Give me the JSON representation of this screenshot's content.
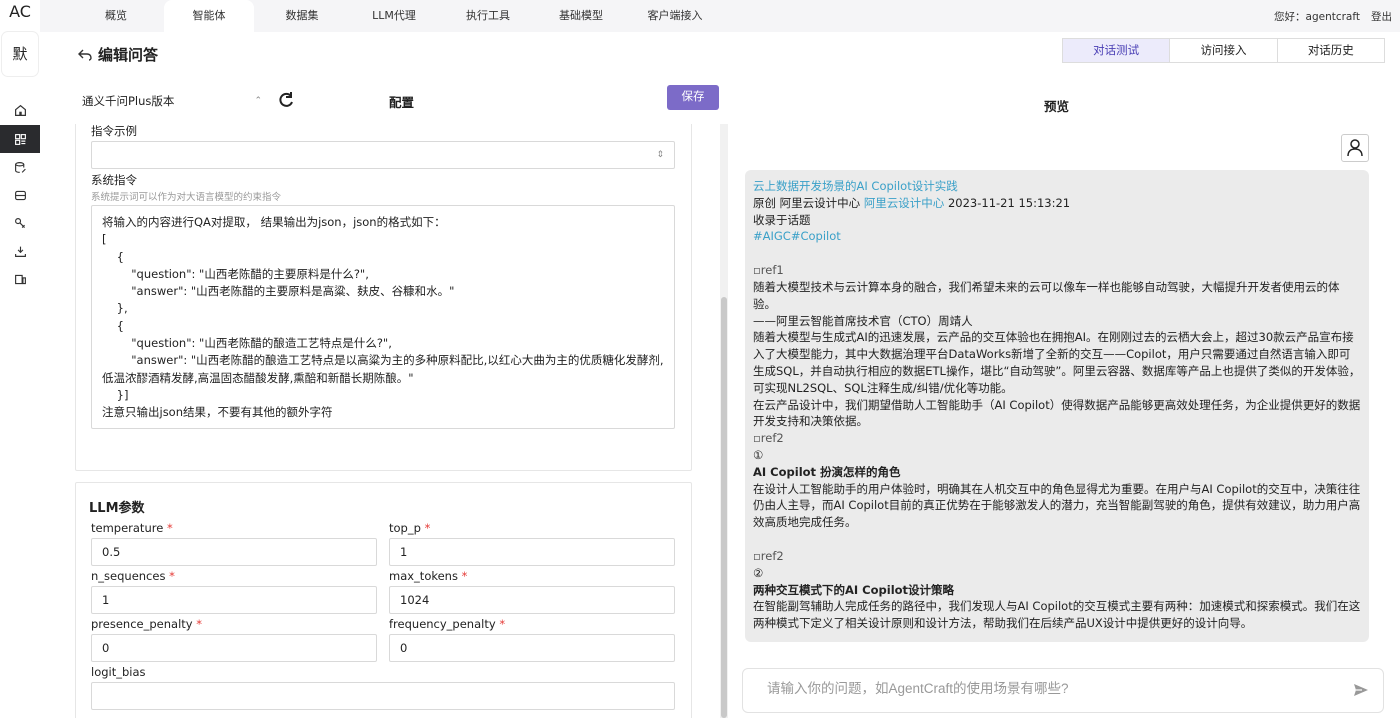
{
  "brand": {
    "logo": "AC",
    "avatar_char": "默"
  },
  "topnav": {
    "items": [
      "概览",
      "智能体",
      "数据集",
      "LLM代理",
      "执行工具",
      "基础模型",
      "客户端接入"
    ],
    "active_index": 1,
    "user_greeting": "您好：agentcraft",
    "logout": "登出"
  },
  "page": {
    "title": "编辑问答",
    "model_select": "通义千问Plus版本",
    "config_title": "配置",
    "save_label": "保存"
  },
  "config": {
    "instruction_example_label": "指令示例",
    "system_instruction_label": "系统指令",
    "system_instruction_help": "系统提示词可以作为对大语言模型的约束指令",
    "system_instruction_value": "将输入的内容进行QA对提取， 结果输出为json，json的格式如下：\n[\n    {\n        \"question\": \"山西老陈醋的主要原料是什么?\",\n        \"answer\": \"山西老陈醋的主要原料是高粱、麸皮、谷糠和水。\"\n    },\n    {\n        \"question\": \"山西老陈醋的酿造工艺特点是什么?\",\n        \"answer\": \"山西老陈醋的酿造工艺特点是以高粱为主的多种原料配比,以红心大曲为主的优质糖化发酵剂,低温浓醪酒精发酵,高温固态醋酸发酵,熏醅和新醋长期陈酿。\"\n    }]\n注意只输出json结果，不要有其他的额外字符",
    "llm_title": "LLM参数",
    "params": {
      "temperature": {
        "label": "temperature",
        "value": "0.5"
      },
      "top_p": {
        "label": "top_p",
        "value": "1"
      },
      "n_sequences": {
        "label": "n_sequences",
        "value": "1"
      },
      "max_tokens": {
        "label": "max_tokens",
        "value": "1024"
      },
      "presence_penalty": {
        "label": "presence_penalty",
        "value": "0"
      },
      "frequency_penalty": {
        "label": "frequency_penalty",
        "value": "0"
      },
      "logit_bias": {
        "label": "logit_bias",
        "value": ""
      }
    }
  },
  "right": {
    "tabs": [
      "对话测试",
      "访问接入",
      "对话历史"
    ],
    "active_tab": 0,
    "preview_title": "预览",
    "chat": {
      "title": "云上数据开发场景的AI Copilot设计实践",
      "meta_prefix": "原创  阿里云设计中心  ",
      "meta_link": "阿里云设计中心",
      "meta_time": "  2023-11-21 15:13:21",
      "collected": "收录于话题",
      "tags": "#AIGC#Copilot",
      "ref1": "ref1",
      "p1": "随着大模型技术与云计算本身的融合，我们希望未来的云可以像车一样也能够自动驾驶，大幅提升开发者使用云的体验。",
      "p1b": "——阿里云智能首席技术官（CTO）周靖人",
      "p2": "随着大模型与生成式AI的迅速发展，云产品的交互体验也在拥抱AI。在刚刚过去的云栖大会上，超过30款云产品宣布接入了大模型能力，其中大数据治理平台DataWorks新增了全新的交互——Copilot，用户只需要通过自然语言输入即可生成SQL，并自动执行相应的数据ETL操作，堪比“自动驾驶”。阿里云容器、数据库等产品上也提供了类似的开发体验，可实现NL2SQL、SQL注释生成/纠错/优化等功能。",
      "p3": "在云产品设计中，我们期望借助人工智能助手（AI Copilot）使得数据产品能够更高效处理任务，为企业提供更好的数据开发支持和决策依据。",
      "ref2a": "ref2",
      "num1": "①",
      "h1": "AI Copilot 扮演怎样的角色",
      "p4": "在设计人工智能助手的用户体验时，明确其在人机交互中的角色显得尤为重要。在用户与AI Copilot的交互中，决策往往仍由人主导，而AI Copilot目前的真正优势在于能够激发人的潜力，充当智能副驾驶的角色，提供有效建议，助力用户高效高质地完成任务。",
      "ref2b": "ref2",
      "num2": "②",
      "h2": "两种交互模式下的AI Copilot设计策略",
      "p5": "在智能副驾辅助人完成任务的路径中，我们发现人与AI Copilot的交互模式主要有两种：加速模式和探索模式。我们在这两种模式下定义了相关设计原则和设计方法，帮助我们在后续产品UX设计中提供更好的设计向导。"
    },
    "input_placeholder": "请输入你的问题，如AgentCraft的使用场景有哪些?"
  },
  "colors": {
    "accent": "#7c6bc8",
    "link": "#3aa0c8",
    "rail_active": "#2a2b2e"
  }
}
